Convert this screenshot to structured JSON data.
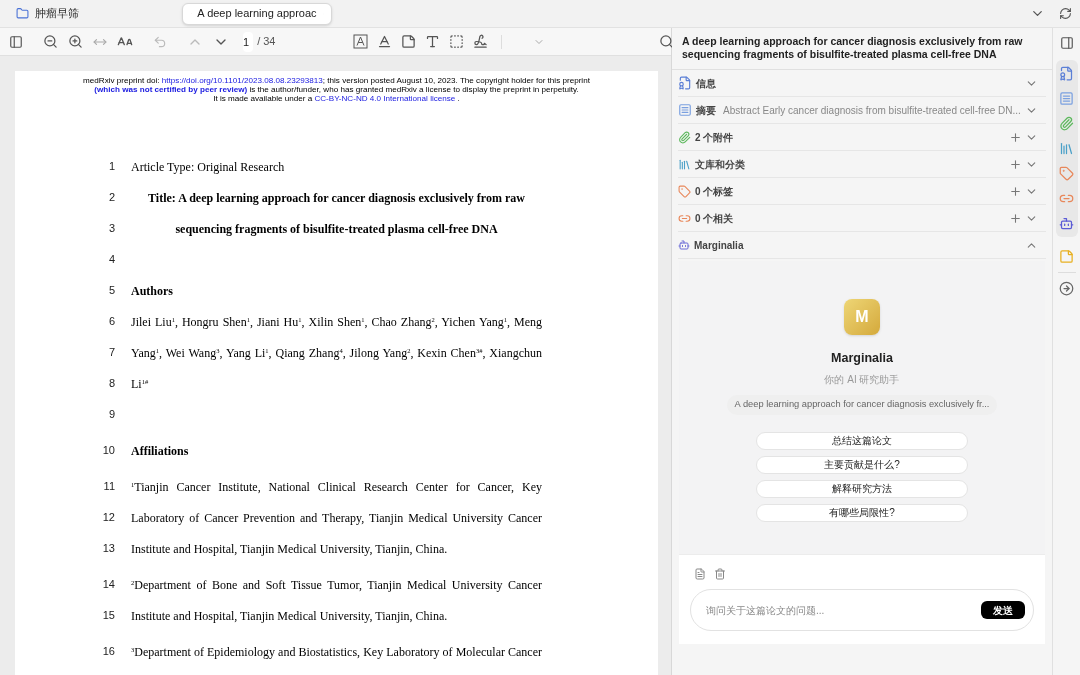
{
  "tabs": [
    {
      "label": "肿瘤早筛",
      "kind": "library",
      "selected": false
    },
    {
      "label": "A deep learning approac",
      "kind": "pdf",
      "selected": true,
      "closable": true
    }
  ],
  "toolbar": {
    "page_number": "1",
    "page_total": "/ 34"
  },
  "pdf": {
    "header": [
      [
        {
          "text": "medRxiv preprint doi: ",
          "kind": "plain"
        },
        {
          "text": "https://doi.org/10.1101/2023.08.08.23293813",
          "kind": "link"
        },
        {
          "text": "; this version posted August 10, 2023. The copyright holder for this preprint",
          "kind": "plain"
        }
      ],
      [
        {
          "text": "(which was not certified by peer review)",
          "kind": "bold_link"
        },
        {
          "text": " is the author/funder, who has granted medRxiv a license to display the preprint in perpetuity.",
          "kind": "plain"
        }
      ],
      [
        {
          "text": "It is made available under a ",
          "kind": "plain"
        },
        {
          "text": "CC-BY-NC-ND 4.0 International license",
          "kind": "link"
        },
        {
          "text": " .",
          "kind": "plain"
        }
      ]
    ],
    "paragraphs": [
      {
        "lines": [
          {
            "number": "1",
            "text": "Article Type: Original Research",
            "kind": "left"
          },
          {
            "number": "2",
            "text": "Title: A deep learning approach for cancer diagnosis exclusively from raw",
            "kind": "title"
          },
          {
            "number": "3",
            "text": "sequencing fragments of bisulfite-treated plasma cell-free DNA",
            "kind": "title"
          },
          {
            "number": "4",
            "kind": "left"
          },
          {
            "number": "5",
            "text": "Authors",
            "kind": "heading"
          },
          {
            "number": "6",
            "text": "Jilei Liu$^{1}$, Hongru Shen$^{1}$, Jiani Hu$^{1}$, Xilin Shen$^{1}$, Chao Zhang$^{2}$, Yichen Yang$^{1}$, Meng",
            "kind": "justify"
          },
          {
            "number": "7",
            "text": "Yang$^{1}$, Wei Wang$^{3}$, Yang Li$^{1}$, Qiang Zhang$^{4}$, Jilong Yang$^{2}$, Kexin Chen$^{3#}$, Xiangchun",
            "kind": "justify"
          },
          {
            "number": "8",
            "text": "Li$^{1#}$",
            "kind": "left"
          },
          {
            "number": "9",
            "kind": "left"
          }
        ]
      },
      {
        "lines": [
          {
            "number": "10",
            "text": "Affiliations",
            "kind": "heading"
          }
        ]
      },
      {
        "lines": [
          {
            "number": "11",
            "text": "$^{1}$Tianjin Cancer Institute, National Clinical Research Center for Cancer, Key",
            "kind": "justify"
          },
          {
            "number": "12",
            "text": "Laboratory of Cancer Prevention and Therapy, Tianjin Medical University Cancer",
            "kind": "justify"
          },
          {
            "number": "13",
            "text": "Institute and Hospital, Tianjin Medical University, Tianjin, China.",
            "kind": "left"
          }
        ]
      },
      {
        "lines": [
          {
            "number": "14",
            "text": "$^{2}$Department of Bone and Soft Tissue Tumor, Tianjin Medical University Cancer",
            "kind": "justify"
          },
          {
            "number": "15",
            "text": "Institute and Hospital, Tianjin Medical University, Tianjin, China.",
            "kind": "left"
          }
        ]
      },
      {
        "lines": [
          {
            "number": "16",
            "text": "$^{3}$Department of Epidemiology and Biostatistics, Key Laboratory of Molecular Cancer",
            "kind": "justify"
          }
        ]
      }
    ]
  },
  "item_pane": {
    "title": "A deep learning approach for cancer diagnosis exclusively from raw sequencing fragments of bisulfite-treated plasma cell-free DNA",
    "sections": [
      {
        "label": "信息",
        "expanded": false,
        "add_button": false
      },
      {
        "label": "摘要",
        "summary": "Abstract Early cancer diagnosis from bisulfite-treated cell-free DN...",
        "expanded": false,
        "add_button": false
      },
      {
        "label": "2 个附件",
        "expanded": false,
        "add_button": true
      },
      {
        "label": "文库和分类",
        "expanded": false,
        "add_button": true
      },
      {
        "label": "0 个标签",
        "expanded": false,
        "add_button": true
      },
      {
        "label": "0 个相关",
        "expanded": false,
        "add_button": true
      },
      {
        "label": "Marginalia",
        "expanded": true,
        "add_button": false
      }
    ]
  },
  "assistant": {
    "logo": "M",
    "name": "Marginalia",
    "subtitle": "你的 AI 研究助手",
    "document": "A deep learning approach for cancer diagnosis exclusively fr...",
    "suggestions": [
      "总结这篇论文",
      "主要贡献是什么?",
      "解释研究方法",
      "有哪些局限性?"
    ],
    "placeholder": "询问关于这篇论文的问题...",
    "send": "发送"
  }
}
